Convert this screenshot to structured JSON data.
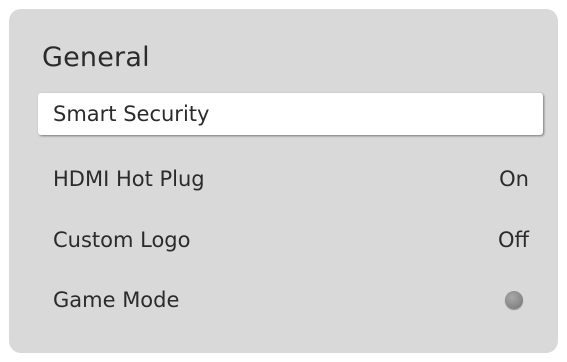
{
  "panel": {
    "title": "General"
  },
  "menu": {
    "items": [
      {
        "label": "Smart Security",
        "value": ""
      },
      {
        "label": "HDMI Hot Plug",
        "value": "On"
      },
      {
        "label": "Custom Logo",
        "value": "Off"
      },
      {
        "label": "Game Mode",
        "value": "",
        "icon": "toggle-off-icon"
      }
    ]
  }
}
